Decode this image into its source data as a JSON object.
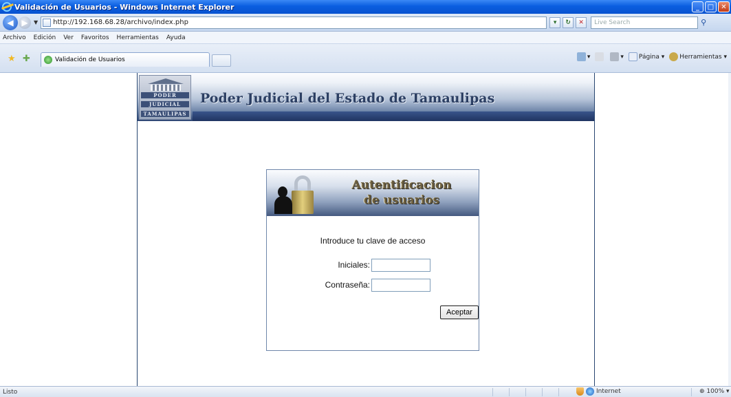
{
  "window": {
    "title": "Validación de Usuarios - Windows Internet Explorer",
    "buttons": {
      "minimize": "_",
      "maximize": "□",
      "close": "✕"
    }
  },
  "address": {
    "url": "http://192.168.68.28/archivo/index.php",
    "search_placeholder": "Live Search"
  },
  "menu": {
    "items": [
      "Archivo",
      "Edición",
      "Ver",
      "Favoritos",
      "Herramientas",
      "Ayuda"
    ]
  },
  "tabs": {
    "active_label": "Validación de Usuarios"
  },
  "command_bar": {
    "page_label": "Página",
    "tools_label": "Herramientas"
  },
  "page": {
    "banner_title": "Poder Judicial del Estado de Tamaulipas",
    "logo_lines": [
      "PODER",
      "JUDICIAL",
      "TAMAULIPAS"
    ],
    "login": {
      "title_line1": "Autentificacion",
      "title_line2": "de usuarios",
      "intro": "Introduce tu clave de acceso",
      "initials_label": "Iniciales:",
      "password_label": "Contraseña:",
      "initials_value": "",
      "password_value": "",
      "submit_label": "Aceptar"
    }
  },
  "status": {
    "text": "Listo",
    "zone": "Internet",
    "zoom": "100%"
  },
  "colors": {
    "titlebar": "#0a5ee0",
    "banner_dark": "#1f3461",
    "banner_text": "#2c3f63",
    "login_title": "#6b5e3f"
  }
}
